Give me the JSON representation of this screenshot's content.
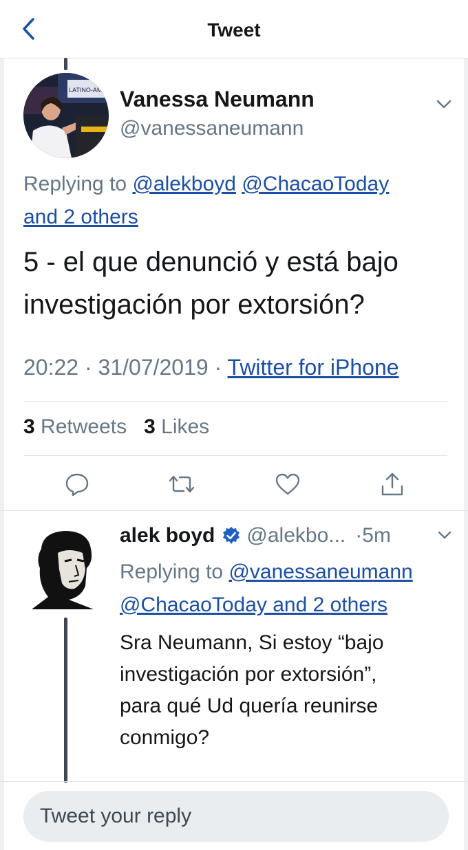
{
  "header": {
    "title": "Tweet"
  },
  "main_tweet": {
    "display_name": "Vanessa Neumann",
    "handle": "@vanessaneumann",
    "replying_prefix": "Replying to ",
    "replying_mentions": [
      "@alekboyd",
      "@ChacaoToday",
      "and 2 others"
    ],
    "text_lines": [
      "5 - el que denunció y está bajo",
      "investigación por extorsión?"
    ],
    "time": "20:22",
    "date": "31/07/2019",
    "separator": " · ",
    "source": "Twitter for iPhone",
    "retweets_count": "3",
    "retweets_label": "Retweets",
    "likes_count": "3",
    "likes_label": "Likes",
    "avatar_text": [
      "LATINO-AMERI"
    ]
  },
  "reply_tweet": {
    "display_name": "alek boyd",
    "handle": "@alekbo...",
    "time": "·5m",
    "replying_prefix": "Replying to ",
    "replying_mentions": [
      "@vanessaneumann",
      "@ChacaoToday and 2 others"
    ],
    "text_lines": [
      "Sra Neumann, Si estoy “bajo",
      "investigación por extorsión”,",
      "para qué Ud quería reunirse",
      "conmigo?"
    ]
  },
  "composer": {
    "placeholder": "Tweet your reply"
  },
  "icons": {
    "back": "chevron-left-icon",
    "more": "chevron-down-icon",
    "reply": "reply-icon",
    "retweet": "retweet-icon",
    "like": "heart-icon",
    "share": "share-icon",
    "verified": "verified-badge-icon"
  },
  "colors": {
    "link": "#1b4fa6",
    "secondary": "#657786",
    "verified": "#1d9bf0",
    "thread_line": "#3d4852"
  }
}
